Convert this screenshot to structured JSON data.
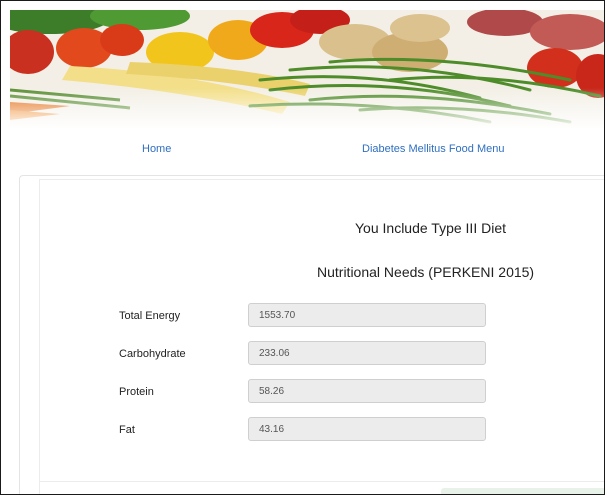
{
  "nav": {
    "home": "Home",
    "food_menu": "Diabetes Mellitus Food Menu"
  },
  "main": {
    "heading_line1": "You Include Type III Diet",
    "heading_line2": "Nutritional Needs (PERKENI 2015)",
    "rows": [
      {
        "label": "Total Energy",
        "value": "1553.70"
      },
      {
        "label": "Carbohydrate",
        "value": "233.06"
      },
      {
        "label": "Protein",
        "value": "58.26"
      },
      {
        "label": "Fat",
        "value": "43.16"
      }
    ]
  },
  "banner": {
    "image": "vegetables-banner"
  }
}
